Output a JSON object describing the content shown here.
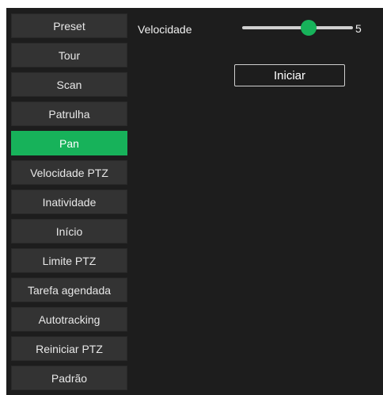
{
  "menu": {
    "items": [
      {
        "label": "Preset",
        "active": false
      },
      {
        "label": "Tour",
        "active": false
      },
      {
        "label": "Scan",
        "active": false
      },
      {
        "label": "Patrulha",
        "active": false
      },
      {
        "label": "Pan",
        "active": true
      },
      {
        "label": "Velocidade PTZ",
        "active": false
      },
      {
        "label": "Inatividade",
        "active": false
      },
      {
        "label": "Início",
        "active": false
      },
      {
        "label": "Limite PTZ",
        "active": false
      },
      {
        "label": "Tarefa agendada",
        "active": false
      },
      {
        "label": "Autotracking",
        "active": false
      },
      {
        "label": "Reiniciar PTZ",
        "active": false
      },
      {
        "label": "Padrão",
        "active": false
      }
    ]
  },
  "pan": {
    "speed_label": "Velocidade",
    "speed_value": "5",
    "speed_fraction": 0.6,
    "start_label": "Iniciar"
  },
  "colors": {
    "accent": "#17b25a",
    "panel": "#1d1d1d",
    "menu_item": "#333333"
  }
}
